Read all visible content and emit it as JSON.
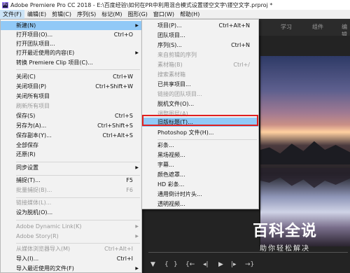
{
  "window": {
    "title": "Adobe Premiere Pro CC 2018 - E:\\百度经验\\如何在PR中利用混合模式设置镂空文字\\镂空文字.prproj *"
  },
  "menubar": [
    "文件(F)",
    "编辑(E)",
    "剪辑(C)",
    "序列(S)",
    "标记(M)",
    "图形(G)",
    "窗口(W)",
    "帮助(H)"
  ],
  "workspace_tabs": [
    "学习",
    "组件",
    "编辑"
  ],
  "file_menu": [
    {
      "label": "新建(N)",
      "shortcut": "",
      "arrow": true,
      "state": "highlight"
    },
    {
      "label": "打开项目(O)...",
      "shortcut": "Ctrl+O",
      "arrow": false,
      "state": "normal"
    },
    {
      "label": "打开团队项目...",
      "shortcut": "",
      "arrow": false,
      "state": "normal"
    },
    {
      "label": "打开最近使用的内容(E)",
      "shortcut": "",
      "arrow": true,
      "state": "normal"
    },
    {
      "label": "转换 Premiere Clip 项目(C)...",
      "shortcut": "",
      "arrow": false,
      "state": "normal"
    },
    {
      "label": "关闭(C)",
      "shortcut": "Ctrl+W",
      "arrow": false,
      "state": "normal"
    },
    {
      "label": "关闭项目(P)",
      "shortcut": "Ctrl+Shift+W",
      "arrow": false,
      "state": "normal"
    },
    {
      "label": "关闭所有项目",
      "shortcut": "",
      "arrow": false,
      "state": "normal"
    },
    {
      "label": "刷新所有项目",
      "shortcut": "",
      "arrow": false,
      "state": "disabled"
    },
    {
      "label": "保存(S)",
      "shortcut": "Ctrl+S",
      "arrow": false,
      "state": "normal"
    },
    {
      "label": "另存为(A)...",
      "shortcut": "Ctrl+Shift+S",
      "arrow": false,
      "state": "normal"
    },
    {
      "label": "保存副本(Y)...",
      "shortcut": "Ctrl+Alt+S",
      "arrow": false,
      "state": "normal"
    },
    {
      "label": "全部保存",
      "shortcut": "",
      "arrow": false,
      "state": "normal"
    },
    {
      "label": "还原(R)",
      "shortcut": "",
      "arrow": false,
      "state": "normal"
    },
    {
      "label": "同步设置",
      "shortcut": "",
      "arrow": true,
      "state": "normal"
    },
    {
      "label": "捕捉(T)...",
      "shortcut": "F5",
      "arrow": false,
      "state": "normal"
    },
    {
      "label": "批量捕捉(B)...",
      "shortcut": "F6",
      "arrow": false,
      "state": "disabled"
    },
    {
      "label": "链接媒体(L)...",
      "shortcut": "",
      "arrow": false,
      "state": "disabled"
    },
    {
      "label": "设为脱机(O)...",
      "shortcut": "",
      "arrow": false,
      "state": "normal"
    },
    {
      "label": "Adobe Dynamic Link(K)",
      "shortcut": "",
      "arrow": true,
      "state": "disabled"
    },
    {
      "label": "Adobe Story(R)",
      "shortcut": "",
      "arrow": true,
      "state": "disabled"
    },
    {
      "label": "从媒体浏览器导入(M)",
      "shortcut": "Ctrl+Alt+I",
      "arrow": false,
      "state": "disabled"
    },
    {
      "label": "导入(I)...",
      "shortcut": "Ctrl+I",
      "arrow": false,
      "state": "normal"
    },
    {
      "label": "导入最近使用的文件(F)",
      "shortcut": "",
      "arrow": true,
      "state": "normal"
    }
  ],
  "new_submenu": [
    {
      "label": "项目(P)...",
      "shortcut": "Ctrl+Alt+N",
      "state": "normal"
    },
    {
      "label": "团队项目...",
      "shortcut": "",
      "state": "normal"
    },
    {
      "label": "序列(S)...",
      "shortcut": "Ctrl+N",
      "state": "normal"
    },
    {
      "label": "来自剪辑的序列",
      "shortcut": "",
      "state": "disabled"
    },
    {
      "label": "素材箱(B)",
      "shortcut": "Ctrl+/",
      "state": "disabled"
    },
    {
      "label": "搜索素材箱",
      "shortcut": "",
      "state": "disabled"
    },
    {
      "label": "已共享项目...",
      "shortcut": "",
      "state": "normal"
    },
    {
      "label": "链接的团队项目...",
      "shortcut": "",
      "state": "disabled"
    },
    {
      "label": "脱机文件(O)...",
      "shortcut": "",
      "state": "normal"
    },
    {
      "label": "调整图层(A)...",
      "shortcut": "",
      "state": "disabled"
    },
    {
      "label": "旧版标题(T)...",
      "shortcut": "",
      "state": "highlight"
    },
    {
      "label": "Photoshop 文件(H)...",
      "shortcut": "",
      "state": "normal"
    },
    {
      "label": "彩条...",
      "shortcut": "",
      "state": "normal"
    },
    {
      "label": "黑场视频...",
      "shortcut": "",
      "state": "normal"
    },
    {
      "label": "字幕...",
      "shortcut": "",
      "state": "normal"
    },
    {
      "label": "颜色遮罩...",
      "shortcut": "",
      "state": "normal"
    },
    {
      "label": "HD 彩条...",
      "shortcut": "",
      "state": "normal"
    },
    {
      "label": "通用倒计时片头...",
      "shortcut": "",
      "state": "normal"
    },
    {
      "label": "透明视频...",
      "shortcut": "",
      "state": "normal"
    }
  ],
  "watermark": {
    "title": "百科全说",
    "subtitle": "助你轻松解决"
  },
  "colors": {
    "highlight": "#91c9f7",
    "menu_bg": "#f2f2f2",
    "red_box": "#e02020"
  }
}
